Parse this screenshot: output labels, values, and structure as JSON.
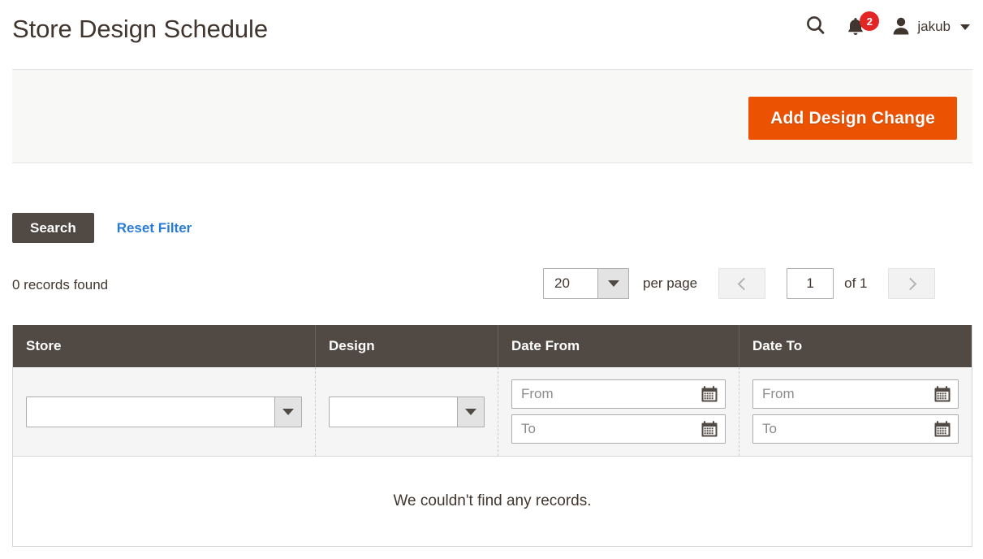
{
  "header": {
    "title": "Store Design Schedule",
    "search_icon": "search-icon",
    "notifications": {
      "icon": "bell-icon",
      "count": "2",
      "badge_color": "#e22626"
    },
    "user": {
      "icon": "user-avatar-icon",
      "name": "jakub",
      "caret": "chevron-down-icon"
    }
  },
  "page_actions": {
    "add_button_label": "Add Design Change",
    "add_button_color": "#eb5202"
  },
  "filter_actions": {
    "search_label": "Search",
    "search_button_color": "#514943",
    "reset_label": "Reset Filter",
    "reset_link_color": "#2a7bd6"
  },
  "pagination": {
    "records_found": "0 records found",
    "per_page_value": "20",
    "per_page_label": "per page",
    "prev_icon": "chevron-left-icon",
    "next_icon": "chevron-right-icon",
    "current_page": "1",
    "total_pages_label": "of 1"
  },
  "grid": {
    "columns": [
      {
        "label": "Store"
      },
      {
        "label": "Design"
      },
      {
        "label": "Date From"
      },
      {
        "label": "Date To"
      }
    ],
    "header_color": "#514943",
    "filters": {
      "store_value": "",
      "design_value": "",
      "date_from": {
        "from_placeholder": "From",
        "to_placeholder": "To"
      },
      "date_to": {
        "from_placeholder": "From",
        "to_placeholder": "To"
      }
    },
    "empty_message": "We couldn't find any records."
  }
}
